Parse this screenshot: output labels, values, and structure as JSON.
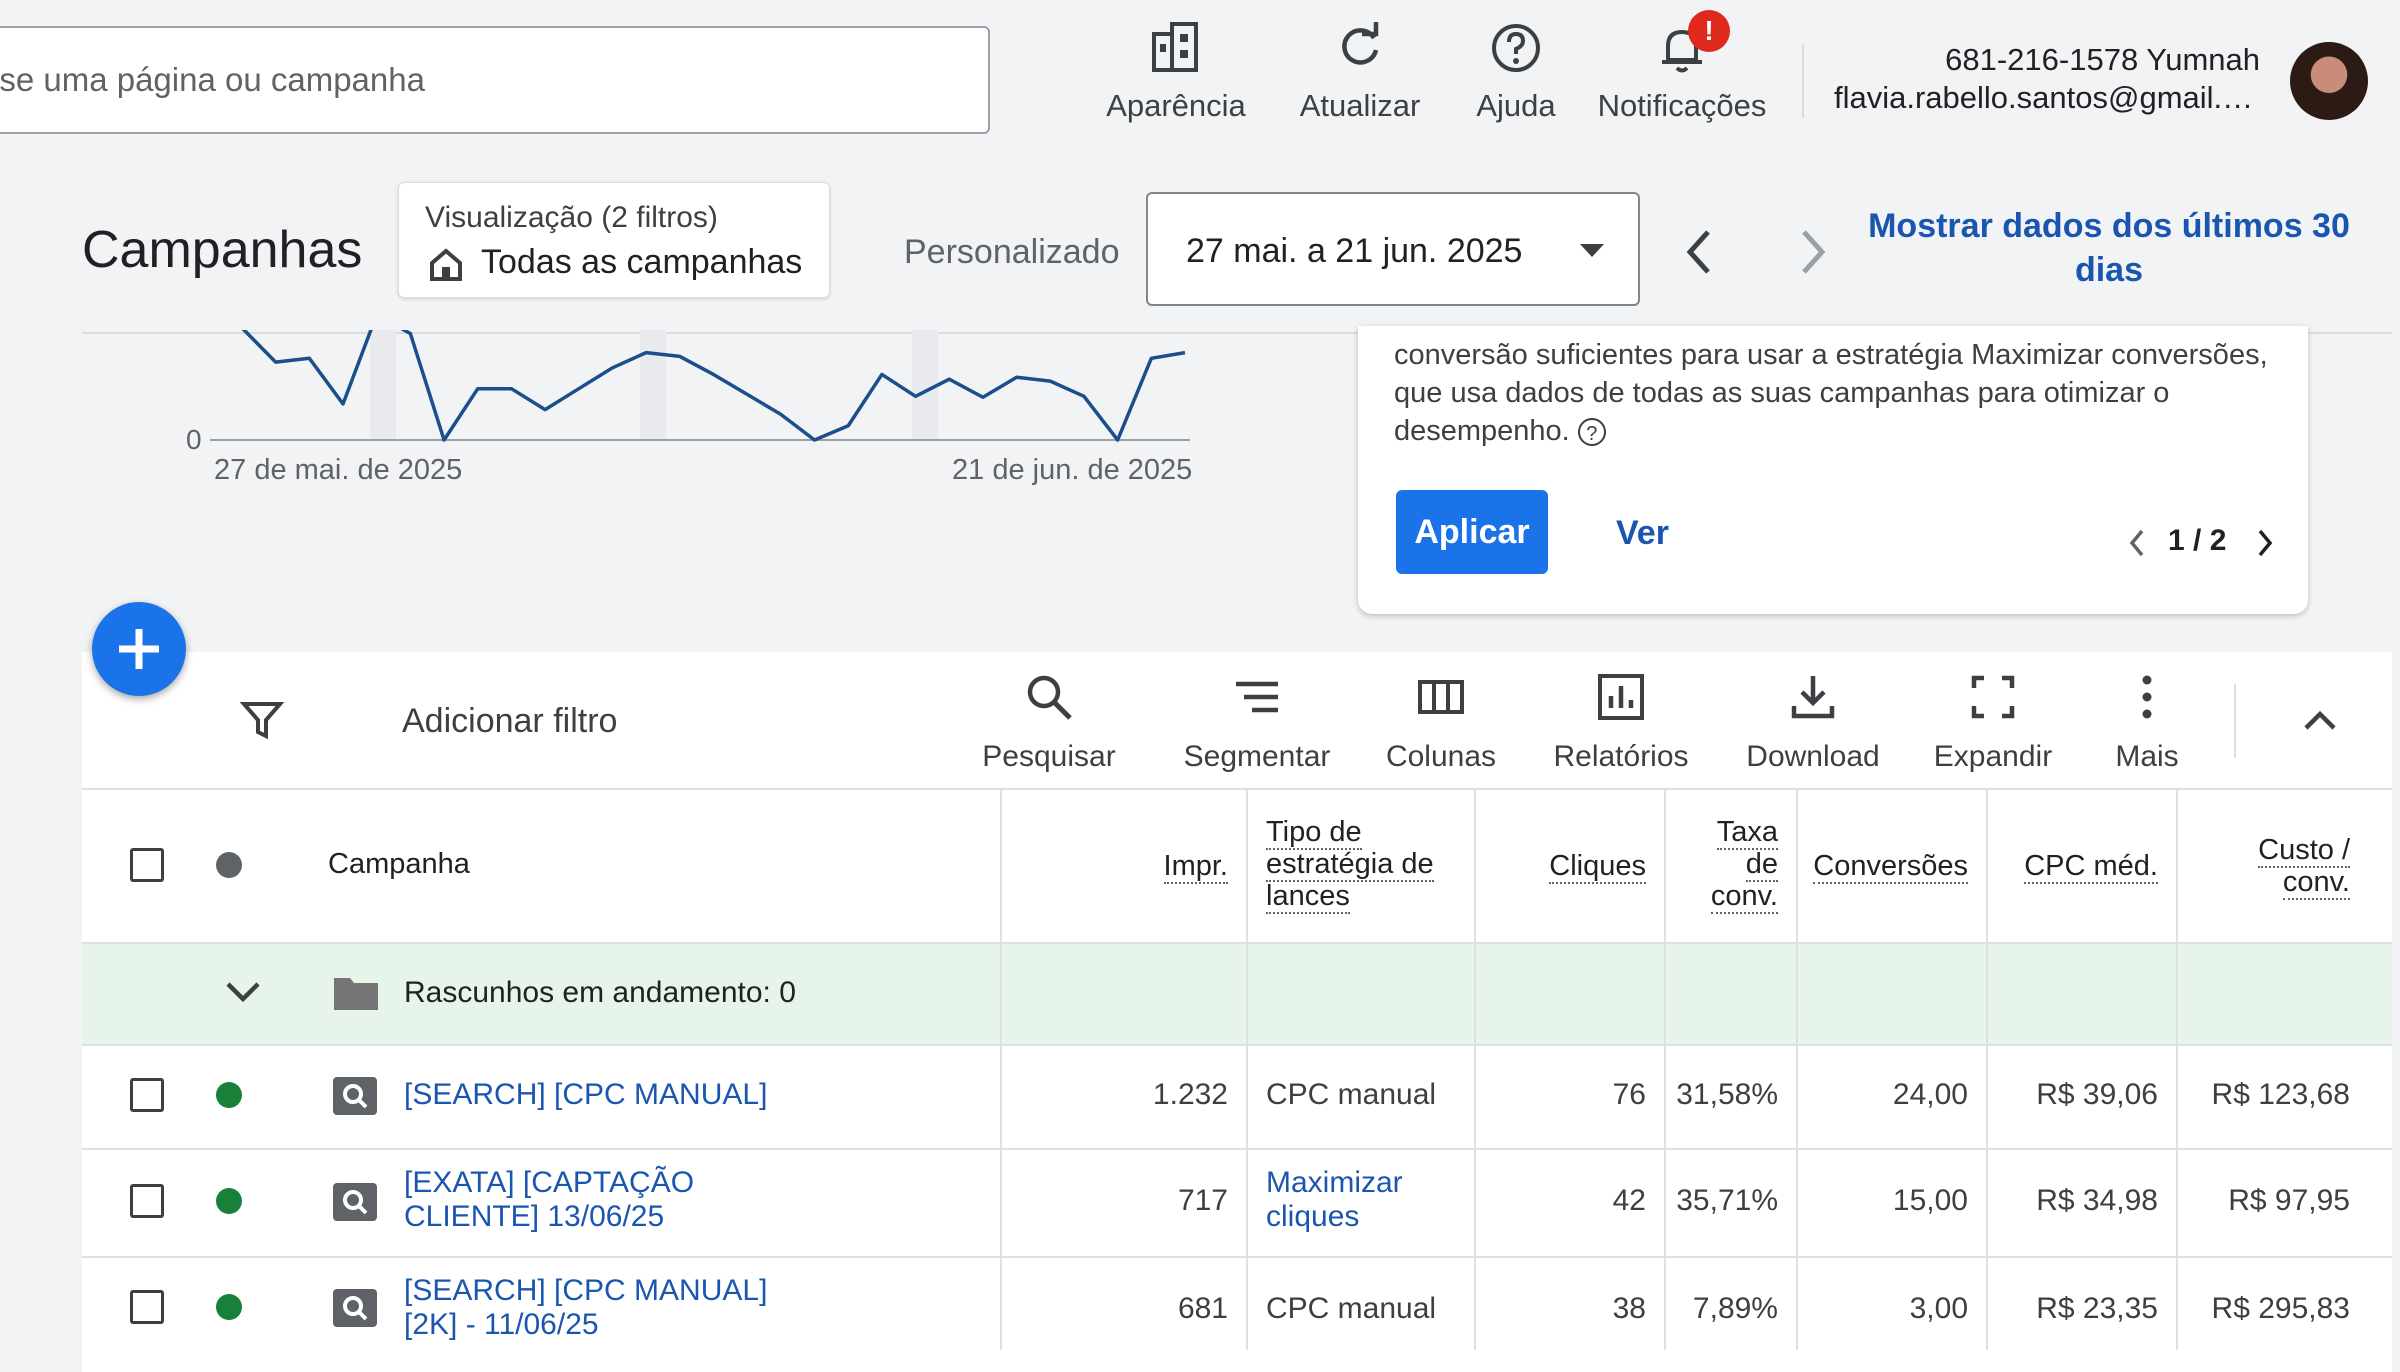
{
  "topbar": {
    "search_placeholder": "ise uma página ou campanha",
    "actions": [
      {
        "label": "Aparência",
        "icon": "appearance-icon"
      },
      {
        "label": "Atualizar",
        "icon": "refresh-icon"
      },
      {
        "label": "Ajuda",
        "icon": "help-icon"
      },
      {
        "label": "Notificações",
        "icon": "bell-icon"
      }
    ],
    "notification_badge": "!",
    "account_line1": "681-216-1578 Yumnah",
    "account_line2": "flavia.rabello.santos@gmail.c…"
  },
  "header": {
    "title": "Campanhas",
    "view_label": "Visualização (2 filtros)",
    "view_value": "Todas as campanhas",
    "period_label": "Personalizado",
    "date_range": "27 mai. a 21 jun. 2025",
    "last30": "Mostrar dados dos últimos 30 dias"
  },
  "chart_data": {
    "type": "line",
    "y_tick": "0",
    "x_start_label": "27 de mai. de 2025",
    "x_end_label": "21 de jun. de 2025",
    "values": [
      118,
      82,
      86,
      38,
      132,
      112,
      0,
      54,
      54,
      32,
      54,
      76,
      92,
      88,
      69,
      48,
      27,
      0,
      15,
      69,
      46,
      64,
      45,
      66,
      62,
      46,
      0,
      86,
      92
    ]
  },
  "recommendation": {
    "text": "conversão suficientes para usar a estratégia Maximizar conversões, que usa dados de todas as suas campanhas para otimizar o desempenho.",
    "help_glyph": "?",
    "apply_label": "Aplicar",
    "view_label": "Ver",
    "pager": "1 / 2"
  },
  "toolbar": {
    "add_filter": "Adicionar filtro",
    "tools": [
      {
        "label": "Pesquisar",
        "icon": "search-icon"
      },
      {
        "label": "Segmentar",
        "icon": "segment-icon"
      },
      {
        "label": "Colunas",
        "icon": "columns-icon"
      },
      {
        "label": "Relatórios",
        "icon": "reports-icon"
      },
      {
        "label": "Download",
        "icon": "download-icon"
      },
      {
        "label": "Expandir",
        "icon": "expand-icon"
      },
      {
        "label": "Mais",
        "icon": "more-icon"
      }
    ]
  },
  "table": {
    "headers": {
      "campaign": "Campanha",
      "impr": "Impr.",
      "bid_line1": "Tipo de",
      "bid_line2": "estratégia de",
      "bid_line3": "lances",
      "clicks": "Cliques",
      "conv_rate_line1": "Taxa",
      "conv_rate_line2": "de",
      "conv_rate_line3": "conv.",
      "conversions": "Conversões",
      "avg_cpc": "CPC méd.",
      "cost_conv_line1": "Custo /",
      "cost_conv_line2": "conv."
    },
    "drafts": "Rascunhos em andamento: 0",
    "rows": [
      {
        "name_line1": "[SEARCH] [CPC MANUAL]",
        "name_line2": "",
        "status_color": "#188038",
        "impr": "1.232",
        "bid_line1": "CPC manual",
        "bid_line2": "",
        "clicks": "76",
        "conv_rate": "31,58%",
        "conversions": "24,00",
        "avg_cpc": "R$ 39,06",
        "cost_conv": "R$ 123,68"
      },
      {
        "name_line1": "[EXATA] [CAPTAÇÃO",
        "name_line2": "CLIENTE] 13/06/25",
        "status_color": "#188038",
        "impr": "717",
        "bid_line1": "Maximizar",
        "bid_line2": "cliques",
        "clicks": "42",
        "conv_rate": "35,71%",
        "conversions": "15,00",
        "avg_cpc": "R$ 34,98",
        "cost_conv": "R$ 97,95"
      },
      {
        "name_line1": "[SEARCH] [CPC MANUAL]",
        "name_line2": "[2K] - 11/06/25",
        "status_color": "#188038",
        "impr": "681",
        "bid_line1": "CPC manual",
        "bid_line2": "",
        "clicks": "38",
        "conv_rate": "7,89%",
        "conversions": "3,00",
        "avg_cpc": "R$ 23,35",
        "cost_conv": "R$ 295,83"
      }
    ]
  }
}
